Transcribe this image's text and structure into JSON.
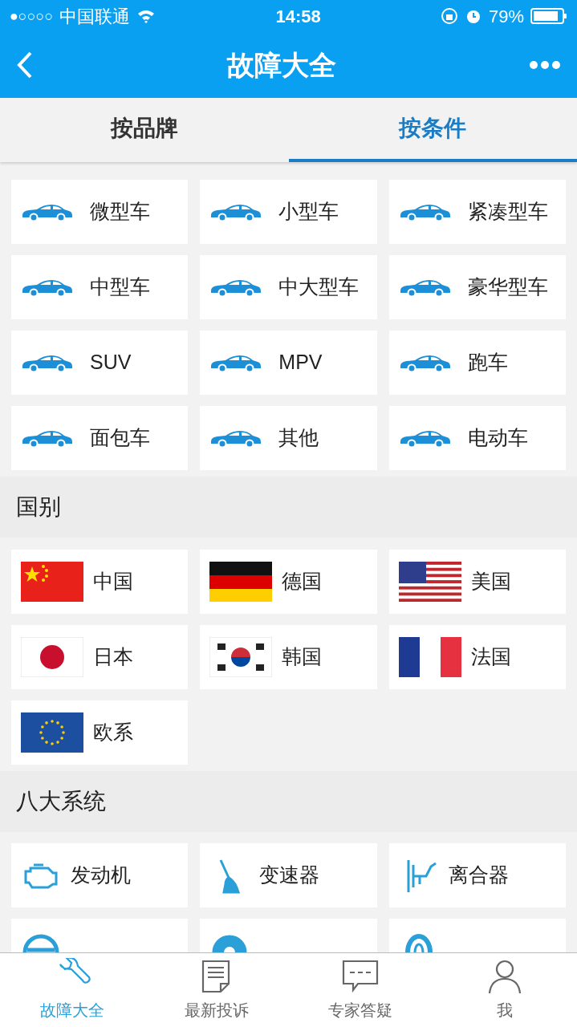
{
  "status_bar": {
    "signal": "●○○○○",
    "carrier": "中国联通",
    "time": "14:58",
    "battery": "79%"
  },
  "nav": {
    "title": "故障大全"
  },
  "tabs": [
    {
      "label": "按品牌",
      "selected": false
    },
    {
      "label": "按条件",
      "selected": true
    }
  ],
  "car_types": [
    "微型车",
    "小型车",
    "紧凑型车",
    "中型车",
    "中大型车",
    "豪华型车",
    "SUV",
    "MPV",
    "跑车",
    "面包车",
    "其他",
    "电动车"
  ],
  "countries": {
    "title": "国别",
    "items": [
      {
        "label": "中国",
        "kind": "china"
      },
      {
        "label": "德国",
        "kind": "germany"
      },
      {
        "label": "美国",
        "kind": "usa"
      },
      {
        "label": "日本",
        "kind": "japan"
      },
      {
        "label": "韩国",
        "kind": "korea"
      },
      {
        "label": "法国",
        "kind": "france"
      },
      {
        "label": "欧系",
        "kind": "europe"
      }
    ]
  },
  "systems": {
    "title": "八大系统",
    "items": [
      {
        "label": "发动机",
        "kind": "engine"
      },
      {
        "label": "变速器",
        "kind": "gearbox"
      },
      {
        "label": "离合器",
        "kind": "clutch"
      },
      {
        "kind": "steering"
      },
      {
        "kind": "brake"
      },
      {
        "kind": "tire"
      }
    ]
  },
  "bottom_tabs": [
    {
      "label": "故障大全",
      "kind": "wrench",
      "selected": true
    },
    {
      "label": "最新投诉",
      "kind": "document",
      "selected": false
    },
    {
      "label": "专家答疑",
      "kind": "chat",
      "selected": false
    },
    {
      "label": "我",
      "kind": "person",
      "selected": false
    }
  ]
}
